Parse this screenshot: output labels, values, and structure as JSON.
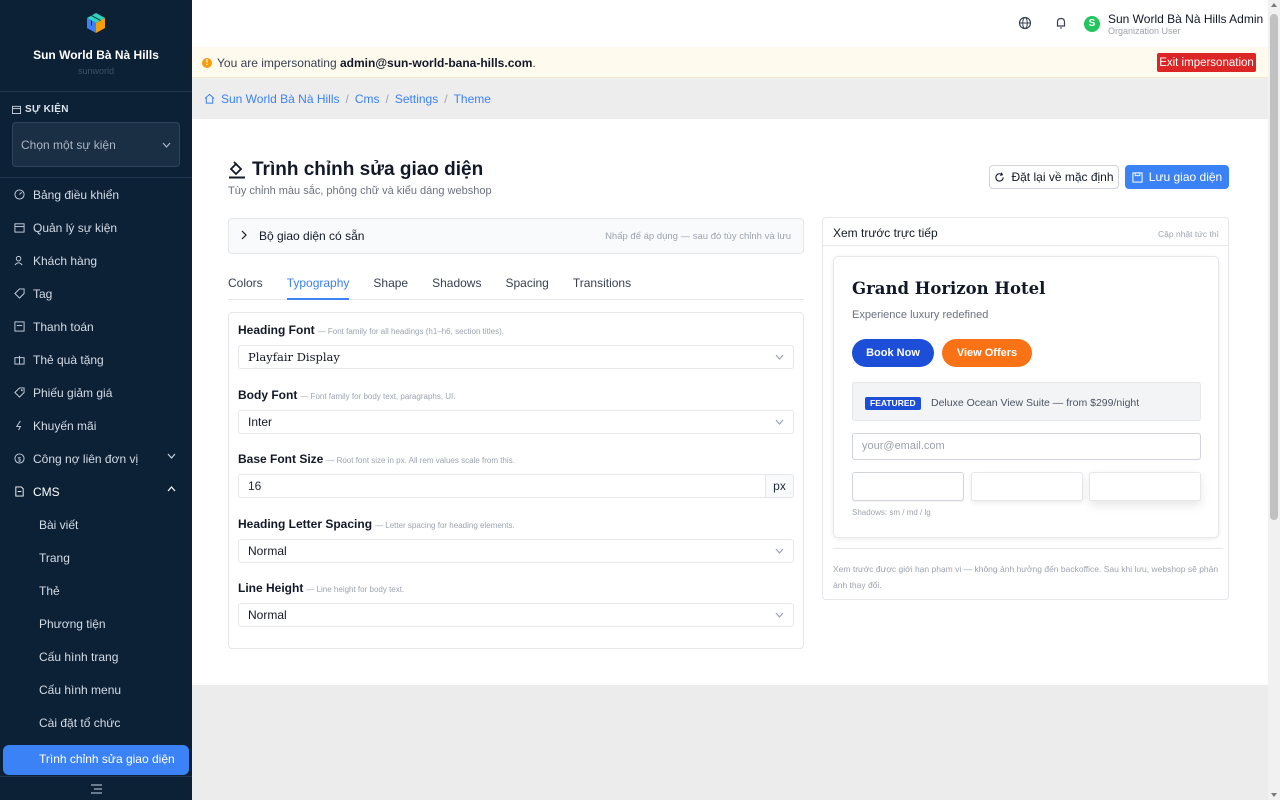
{
  "sidebar": {
    "brand_name": "Sun World Bà Nà Hills",
    "brand_sub": "sunworld",
    "section_label": "SỰ KIỆN",
    "event_select_placeholder": "Chọn một sự kiện",
    "nav": [
      {
        "label": "Bảng điều khiển",
        "icon": "dashboard-icon"
      },
      {
        "label": "Quản lý sự kiện",
        "icon": "calendar-icon"
      },
      {
        "label": "Khách hàng",
        "icon": "users-icon"
      },
      {
        "label": "Tag",
        "icon": "tag-icon"
      },
      {
        "label": "Thanh toán",
        "icon": "payment-icon"
      },
      {
        "label": "Thẻ quà tặng",
        "icon": "gift-icon"
      },
      {
        "label": "Phiếu giảm giá",
        "icon": "coupon-icon"
      },
      {
        "label": "Khuyến mãi",
        "icon": "promo-icon"
      },
      {
        "label": "Công nợ liên đơn vị",
        "icon": "debt-icon"
      },
      {
        "label": "CMS",
        "icon": "document-icon"
      }
    ],
    "cms_sub": [
      "Bài viết",
      "Trang",
      "Thẻ",
      "Phương tiện",
      "Cấu hình trang",
      "Cấu hình menu",
      "Cài đặt tổ chức"
    ],
    "active_item": "Trình chỉnh sửa giao diện"
  },
  "topbar": {
    "user_initial": "S",
    "user_name": "Sun World Bà Nà Hills Admin",
    "user_role": "Organization User"
  },
  "banner": {
    "prefix": "You are impersonating ",
    "email": "admin@sun-world-bana-hills.com",
    "suffix": ".",
    "exit_label": "Exit impersonation"
  },
  "breadcrumb": [
    "Sun World Bà Nà Hills",
    "Cms",
    "Settings",
    "Theme"
  ],
  "page": {
    "title": "Trình chỉnh sửa giao diện",
    "subtitle": "Tùy chỉnh màu sắc, phông chữ và kiểu dáng webshop",
    "reset_label": "Đặt lại về mặc định",
    "save_label": "Lưu giao diện"
  },
  "presets": {
    "title": "Bộ giao diện có sẵn",
    "hint": "Nhấp để áp dụng — sau đó tùy chỉnh và lưu"
  },
  "tabs": [
    "Colors",
    "Typography",
    "Shape",
    "Shadows",
    "Spacing",
    "Transitions"
  ],
  "active_tab": "Typography",
  "fields": {
    "heading_font": {
      "label": "Heading Font",
      "hint": "— Font family for all headings (h1–h6, section titles).",
      "value": "Playfair Display"
    },
    "body_font": {
      "label": "Body Font",
      "hint": "— Font family for body text, paragraphs, UI.",
      "value": "Inter"
    },
    "base_size": {
      "label": "Base Font Size",
      "hint": "— Root font size in px. All rem values scale from this.",
      "value": "16",
      "unit": "px"
    },
    "letter_spacing": {
      "label": "Heading Letter Spacing",
      "hint": "— Letter spacing for heading elements.",
      "value": "Normal"
    },
    "line_height": {
      "label": "Line Height",
      "hint": "— Line height for body text.",
      "value": "Normal"
    }
  },
  "preview": {
    "title": "Xem trước trực tiếp",
    "hint": "Cập nhật tức thì",
    "hotel": "Grand Horizon Hotel",
    "tagline": "Experience luxury redefined",
    "btn_primary": "Book Now",
    "btn_secondary": "View Offers",
    "badge": "FEATURED",
    "feature_text": "Deluxe Ocean View Suite — from $299/night",
    "email_placeholder": "your@email.com",
    "shadows_label": "Shadows: sm / md / lg",
    "note": "Xem trước được giới hạn phạm vi — không ảnh hưởng đến backoffice. Sau khi lưu, webshop sẽ phản ánh thay đổi."
  },
  "colors": {
    "primary": "#1d4ed8",
    "accent": "#f97316",
    "sidebar": "#0d2136",
    "danger": "#dc2626",
    "link": "#3b82f6"
  }
}
